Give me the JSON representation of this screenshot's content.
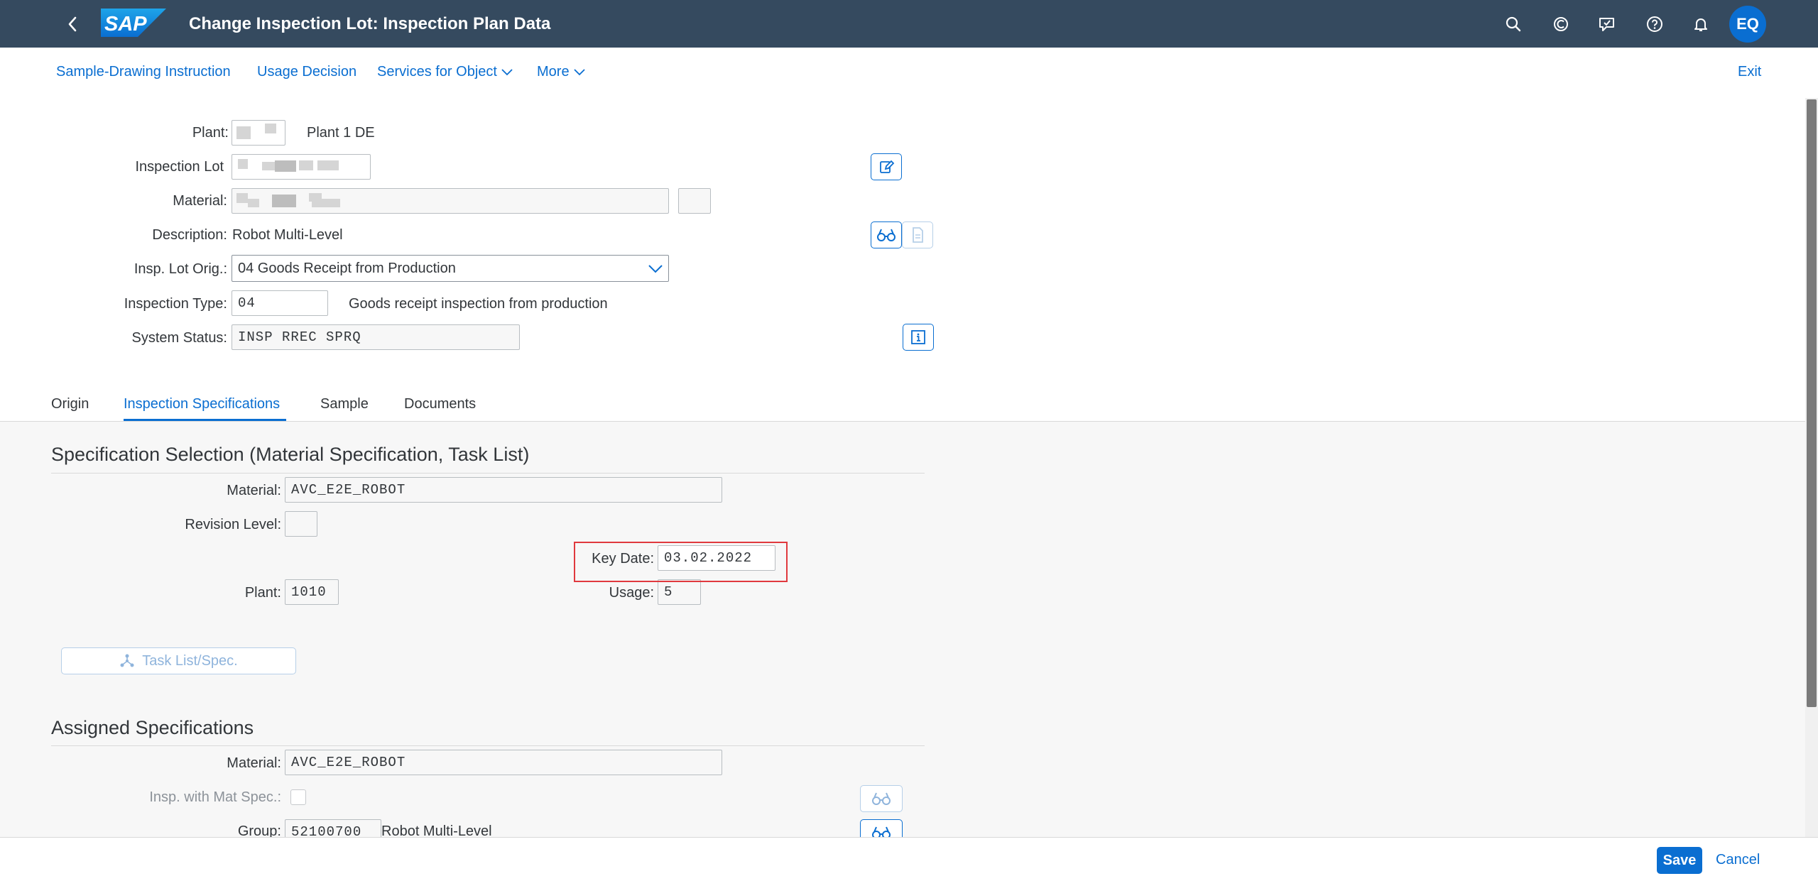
{
  "shell": {
    "title": "Change Inspection Lot: Inspection Plan Data",
    "avatar_initials": "EQ",
    "icons": [
      "back-icon",
      "search-icon",
      "copilot-icon",
      "feedback-icon",
      "help-icon",
      "notification-icon"
    ]
  },
  "toolbar": {
    "sample_drawing": "Sample-Drawing Instruction",
    "usage_decision": "Usage Decision",
    "services": "Services for Object",
    "more": "More",
    "exit": "Exit"
  },
  "header": {
    "plant_label": "Plant:",
    "plant_desc": "Plant 1 DE",
    "insp_lot_label": "Inspection Lot",
    "material_label": "Material:",
    "description_label": "Description:",
    "description_value": "Robot Multi-Level",
    "lot_origin_label": "Insp. Lot Orig.:",
    "lot_origin_value": "04 Goods Receipt from Production",
    "insp_type_label": "Inspection Type:",
    "insp_type_value": "04",
    "insp_type_desc": "Goods receipt inspection from production",
    "system_status_label": "System Status:",
    "system_status_value": "INSP RREC SPRQ"
  },
  "tabs": [
    "Origin",
    "Inspection Specifications",
    "Sample",
    "Documents"
  ],
  "active_tab": "Inspection Specifications",
  "spec_selection": {
    "title": "Specification Selection (Material Specification, Task List)",
    "material_label": "Material:",
    "material_value": "AVC_E2E_ROBOT",
    "revision_label": "Revision Level:",
    "revision_value": "",
    "key_date_label": "Key Date:",
    "key_date_value": "03.02.2022",
    "plant_label": "Plant:",
    "plant_value": "1010",
    "usage_label": "Usage:",
    "usage_value": "5",
    "task_list_button": "Task List/Spec."
  },
  "assigned": {
    "title": "Assigned Specifications",
    "material_label": "Material:",
    "material_value": "AVC_E2E_ROBOT",
    "insp_mat_spec_label": "Insp. with Mat Spec.:",
    "group_label": "Group:",
    "group_value": "52100700",
    "group_desc": "Robot Multi-Level"
  },
  "footer": {
    "save": "Save",
    "cancel": "Cancel"
  },
  "colors": {
    "shell_bg": "#354a5f",
    "accent": "#0a6ed1",
    "highlight": "#e0393e",
    "content_bg": "#f7f7f7"
  }
}
